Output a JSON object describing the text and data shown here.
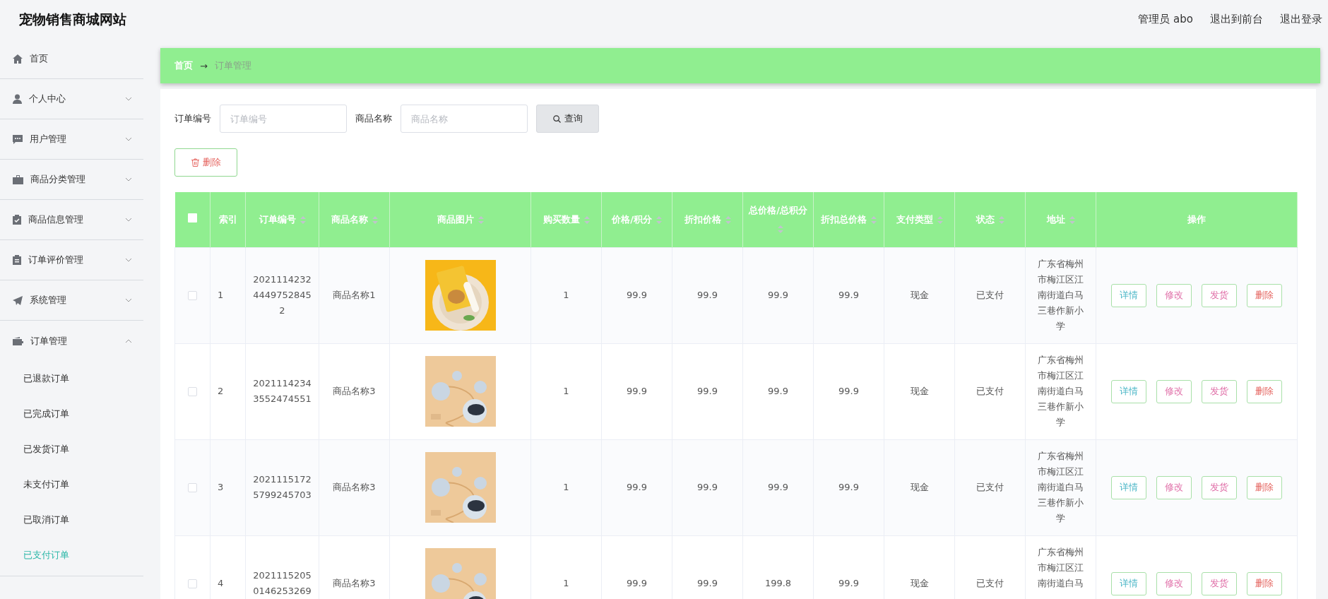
{
  "header": {
    "title": "宠物销售商城网站",
    "links": [
      "管理员 abo",
      "退出到前台",
      "退出登录"
    ]
  },
  "sidebar": {
    "items": [
      {
        "label": "首页",
        "kind": "link",
        "selected": false
      },
      {
        "label": "个人中心",
        "kind": "group",
        "expanded": false,
        "selected": false
      },
      {
        "label": "用户管理",
        "kind": "group",
        "expanded": false,
        "selected": false
      },
      {
        "label": "商品分类管理",
        "kind": "group",
        "expanded": false,
        "selected": false
      },
      {
        "label": "商品信息管理",
        "kind": "group",
        "expanded": false,
        "selected": false
      },
      {
        "label": "订单评价管理",
        "kind": "group",
        "expanded": false,
        "selected": false
      },
      {
        "label": "系统管理",
        "kind": "group",
        "expanded": false,
        "selected": false
      },
      {
        "label": "订单管理",
        "kind": "group",
        "expanded": true,
        "selected": false,
        "children": [
          {
            "label": "已退款订单",
            "selected": false
          },
          {
            "label": "已完成订单",
            "selected": false
          },
          {
            "label": "已发货订单",
            "selected": false
          },
          {
            "label": "未支付订单",
            "selected": false
          },
          {
            "label": "已取消订单",
            "selected": false
          },
          {
            "label": "已支付订单",
            "selected": true
          }
        ]
      }
    ]
  },
  "breadcrumb": {
    "home": "首页",
    "separator": "→",
    "current": "订单管理"
  },
  "search": {
    "fields": [
      {
        "label": "订单编号",
        "placeholder": "订单编号"
      },
      {
        "label": "商品名称",
        "placeholder": "商品名称"
      }
    ],
    "button": "查询"
  },
  "delete_button": "删除",
  "table": {
    "select_all": {
      "checked": false
    },
    "columns": [
      {
        "label": "索引",
        "sortable": false
      },
      {
        "label": "订单编号",
        "sortable": true
      },
      {
        "label": "商品名称",
        "sortable": true
      },
      {
        "label": "商品图片",
        "sortable": true
      },
      {
        "label": "购买数量",
        "sortable": true
      },
      {
        "label": "价格/积分",
        "sortable": true
      },
      {
        "label": "折扣价格",
        "sortable": true
      },
      {
        "label": "总价格/总积分",
        "sortable": true
      },
      {
        "label": "折扣总价格",
        "sortable": true
      },
      {
        "label": "支付类型",
        "sortable": true
      },
      {
        "label": "状态",
        "sortable": true
      },
      {
        "label": "地址",
        "sortable": true
      },
      {
        "label": "操作",
        "sortable": false
      }
    ],
    "rows": [
      {
        "checked": false,
        "cells": [
          "1",
          "202111423244497528452",
          "商品名称1",
          "",
          "1",
          "99.9",
          "99.9",
          "99.9",
          "99.9",
          "现金",
          "已支付",
          "广东省梅州市梅江区江南街道白马三巷作新小学"
        ],
        "actions": [
          "详情",
          "修改",
          "发货",
          "删除"
        ]
      },
      {
        "checked": false,
        "cells": [
          "2",
          "20211142343552474551",
          "商品名称3",
          "",
          "1",
          "99.9",
          "99.9",
          "99.9",
          "99.9",
          "现金",
          "已支付",
          "广东省梅州市梅江区江南街道白马三巷作新小学"
        ],
        "actions": [
          "详情",
          "修改",
          "发货",
          "删除"
        ]
      },
      {
        "checked": false,
        "cells": [
          "3",
          "20211151725799245703",
          "商品名称3",
          "",
          "1",
          "99.9",
          "99.9",
          "99.9",
          "99.9",
          "现金",
          "已支付",
          "广东省梅州市梅江区江南街道白马三巷作新小学"
        ],
        "actions": [
          "详情",
          "修改",
          "发货",
          "删除"
        ]
      },
      {
        "checked": false,
        "cells": [
          "4",
          "20211152050146253269",
          "商品名称3",
          "",
          "1",
          "99.9",
          "99.9",
          "199.8",
          "99.9",
          "现金",
          "已支付",
          "广东省梅州市梅江区江南街道白马"
        ],
        "actions": [
          "详情",
          "修改",
          "发货",
          "删除"
        ]
      }
    ]
  }
}
